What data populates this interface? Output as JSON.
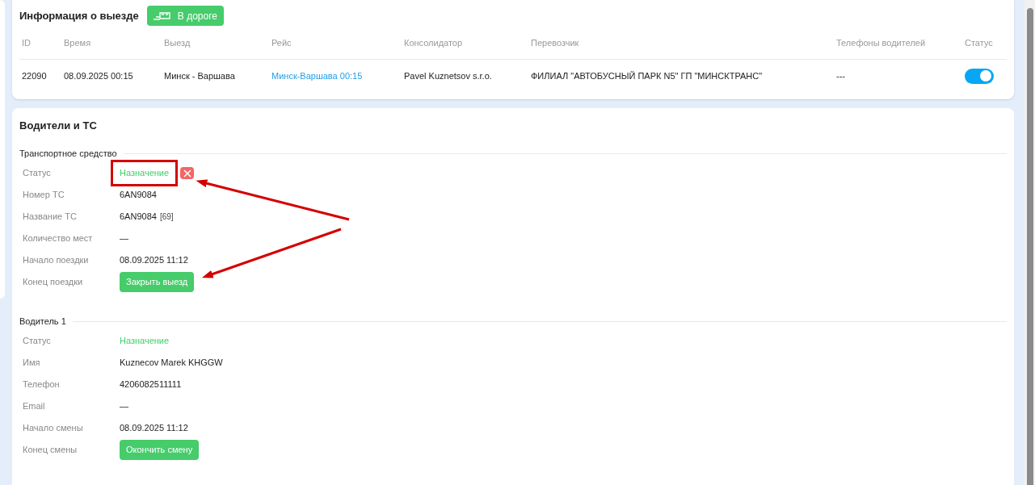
{
  "trip_info": {
    "title": "Информация о выезде",
    "status_badge": "В дороге",
    "columns": [
      "ID",
      "Время",
      "Выезд",
      "Рейс",
      "Консолидатор",
      "Перевозчик",
      "Телефоны водителей",
      "Статус"
    ],
    "row": {
      "id": "22090",
      "time": "08.09.2025 00:15",
      "departure": "Минск - Варшава",
      "route": "Минск-Варшава 00:15",
      "consolidator": "Pavel Kuznetsov s.r.o.",
      "carrier": "ФИЛИАЛ \"АВТОБУСНЫЙ ПАРК N5\" ГП \"МИНСКТРАНС\"",
      "driver_phones": "---",
      "status_on": true
    }
  },
  "drivers_vehicles": {
    "title": "Водители и ТС",
    "sections": [
      {
        "title": "Транспортное средство",
        "fields": [
          {
            "kind": "status",
            "label": "Статус",
            "value": "Назначение",
            "removable": true,
            "highlighted": true
          },
          {
            "kind": "text",
            "label": "Номер ТС",
            "value": "6AN9084"
          },
          {
            "kind": "tagged",
            "label": "Название ТС",
            "value": "6AN9084",
            "tag": "[69]"
          },
          {
            "kind": "text",
            "label": "Количество мест",
            "value": "—"
          },
          {
            "kind": "text",
            "label": "Начало поездки",
            "value": "08.09.2025 11:12"
          },
          {
            "kind": "button",
            "label": "Конец поездки",
            "value": "Закрыть выезд"
          }
        ]
      },
      {
        "title": "Водитель 1",
        "fields": [
          {
            "kind": "status",
            "label": "Статус",
            "value": "Назначение",
            "removable": false,
            "highlighted": false
          },
          {
            "kind": "text",
            "label": "Имя",
            "value": "Kuznecov Marek KHGGW"
          },
          {
            "kind": "text",
            "label": "Телефон",
            "value": "4206082511111"
          },
          {
            "kind": "text",
            "label": "Email",
            "value": "—"
          },
          {
            "kind": "text",
            "label": "Начало смены",
            "value": "08.09.2025 11:12"
          },
          {
            "kind": "button",
            "label": "Конец смены",
            "value": "Окончить смену"
          }
        ]
      }
    ]
  }
}
